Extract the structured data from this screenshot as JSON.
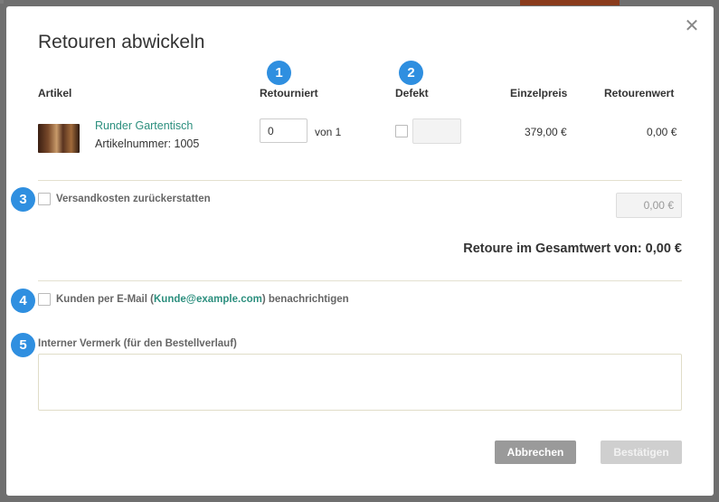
{
  "dialog": {
    "title": "Retouren abwickeln"
  },
  "markers": [
    "1",
    "2",
    "3",
    "4",
    "5"
  ],
  "columns": {
    "artikel": "Artikel",
    "retourniert": "Retourniert",
    "defekt": "Defekt",
    "einzelpreis": "Einzelpreis",
    "retourenwert": "Retourenwert"
  },
  "item": {
    "name": "Runder Gartentisch",
    "sku": "Artikelnummer: 1005",
    "returned_qty": "0",
    "of_text": "von 1",
    "defect_checked": false,
    "unit_price": "379,00 €",
    "return_value": "0,00 €"
  },
  "shipping": {
    "label": "Versandkosten zurückerstatten",
    "value": "0,00 €",
    "checked": false
  },
  "total_text": "Retoure im Gesamtwert von: 0,00 €",
  "notify": {
    "prefix": "Kunden per E-Mail (",
    "email": "Kunde@example.com",
    "suffix": ") benachrichtigen",
    "checked": false
  },
  "note": {
    "label": "Interner Vermerk (für den Bestellverlauf)",
    "value": ""
  },
  "buttons": {
    "cancel": "Abbrechen",
    "confirm": "Bestätigen"
  },
  "colors": {
    "accent_link": "#2c8f7e",
    "marker_blue": "#2f8fe0",
    "overlay": "#6f6f6f"
  }
}
